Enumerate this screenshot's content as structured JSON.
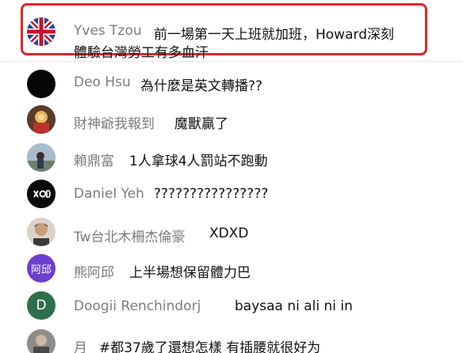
{
  "colors": {
    "highlight": "#e2262a",
    "author_text": "#7c7c7c",
    "message_text": "#111111"
  },
  "messages": [
    {
      "author": "Yves Tzou",
      "text": "前一場第一天上班就加班，Howard深刻",
      "text2": "體驗台灣勞工有多血汗",
      "avatar_icon": "uk-flag-avatar",
      "highlighted": true
    },
    {
      "author": "Deo Hsu",
      "text": "為什麼是英文轉播??",
      "avatar_icon": "black-circle-avatar"
    },
    {
      "author": "財神爺我報到",
      "text": "魔獸贏了",
      "avatar_icon": "deity-figure-avatar"
    },
    {
      "author": "賴鼎富",
      "text": "1人拿球4人罰站不跑動",
      "avatar_icon": "outdoor-photo-avatar"
    },
    {
      "author": "Daniel Yeh",
      "text": "????????????????",
      "avatar_icon": "logo-avatar"
    },
    {
      "author": "Tw台北木柵杰倫豪",
      "text": "XDXD",
      "avatar_icon": "person-photo-avatar"
    },
    {
      "author": "熊阿邱",
      "text": "上半場想保留體力巴",
      "avatar_icon": "text-avatar",
      "avatar_text": "阿邱",
      "avatar_color": "#6d3fd1"
    },
    {
      "author": "Doogii Renchindorj",
      "text": "baysaa ni ali ni in",
      "avatar_icon": "letter-avatar",
      "avatar_text": "D",
      "avatar_color": "#2f6e4a"
    },
    {
      "author": "月",
      "text": "#都37歲了還想怎樣 有插腰就很好为",
      "avatar_icon": "photo-avatar"
    }
  ]
}
